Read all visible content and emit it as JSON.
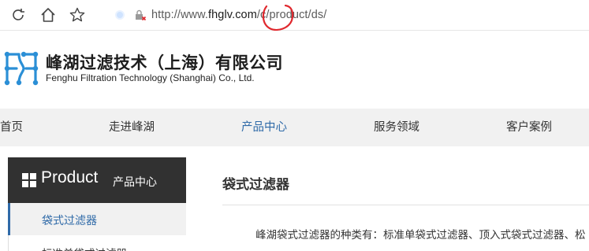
{
  "browser": {
    "url_prefix": "http://www.",
    "url_host": "fhglv.com",
    "url_path": "/c/product/ds/"
  },
  "brand": {
    "name_cn": "峰湖过滤技术（上海）有限公司",
    "name_en": "Fenghu Filtration Technology (Shanghai) Co., Ltd.",
    "logo_color": "#2b8fd6"
  },
  "nav": {
    "items": [
      {
        "label": "首页"
      },
      {
        "label": "走进峰湖"
      },
      {
        "label": "产品中心",
        "active": true
      },
      {
        "label": "服务领域"
      },
      {
        "label": "客户案例"
      }
    ],
    "active_color": "#2f6aa8"
  },
  "sidebar": {
    "title": "Product",
    "subtitle": "产品中心",
    "items": [
      {
        "label": "袋式过滤器",
        "active": true
      },
      {
        "label": "标准单袋式过滤器"
      }
    ]
  },
  "content": {
    "title": "袋式过滤器",
    "intro": "峰湖袋式过滤器的种类有：标准单袋式过滤器、顶入式袋式过滤器、松"
  }
}
